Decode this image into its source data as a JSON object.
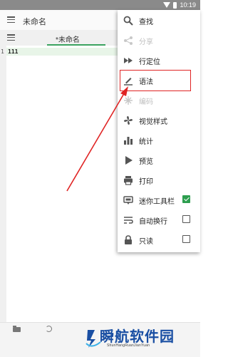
{
  "status_bar": {
    "time": "10:19"
  },
  "app_bar": {
    "title": "未命名"
  },
  "tab": {
    "label": "*未命名"
  },
  "editor": {
    "line_number": "1",
    "line_text": "111"
  },
  "menu": {
    "items": [
      {
        "label": "查找",
        "icon": "search-icon",
        "enabled": true
      },
      {
        "label": "分享",
        "icon": "share-icon",
        "enabled": false
      },
      {
        "label": "行定位",
        "icon": "goto-line-icon",
        "enabled": true
      },
      {
        "label": "语法",
        "icon": "syntax-pen-icon",
        "enabled": true
      },
      {
        "label": "编码",
        "icon": "encoding-icon",
        "enabled": false
      },
      {
        "label": "视觉样式",
        "icon": "fan-icon",
        "enabled": true
      },
      {
        "label": "统计",
        "icon": "bar-chart-icon",
        "enabled": true
      },
      {
        "label": "预览",
        "icon": "play-icon",
        "enabled": true
      },
      {
        "label": "打印",
        "icon": "print-icon",
        "enabled": true
      },
      {
        "label": "迷你工具栏",
        "icon": "mini-toolbar-icon",
        "enabled": true,
        "checked": true
      },
      {
        "label": "自动换行",
        "icon": "wrap-icon",
        "enabled": true,
        "checked": false
      },
      {
        "label": "只读",
        "icon": "lock-icon",
        "enabled": true,
        "checked": false
      }
    ]
  },
  "watermark": {
    "title": "瞬航软件园",
    "subtitle": "ShunHangRuanJianYuan"
  },
  "colors": {
    "accent": "#3aa35f",
    "annotation": "#e02424",
    "watermark": "#1a4fa3"
  }
}
